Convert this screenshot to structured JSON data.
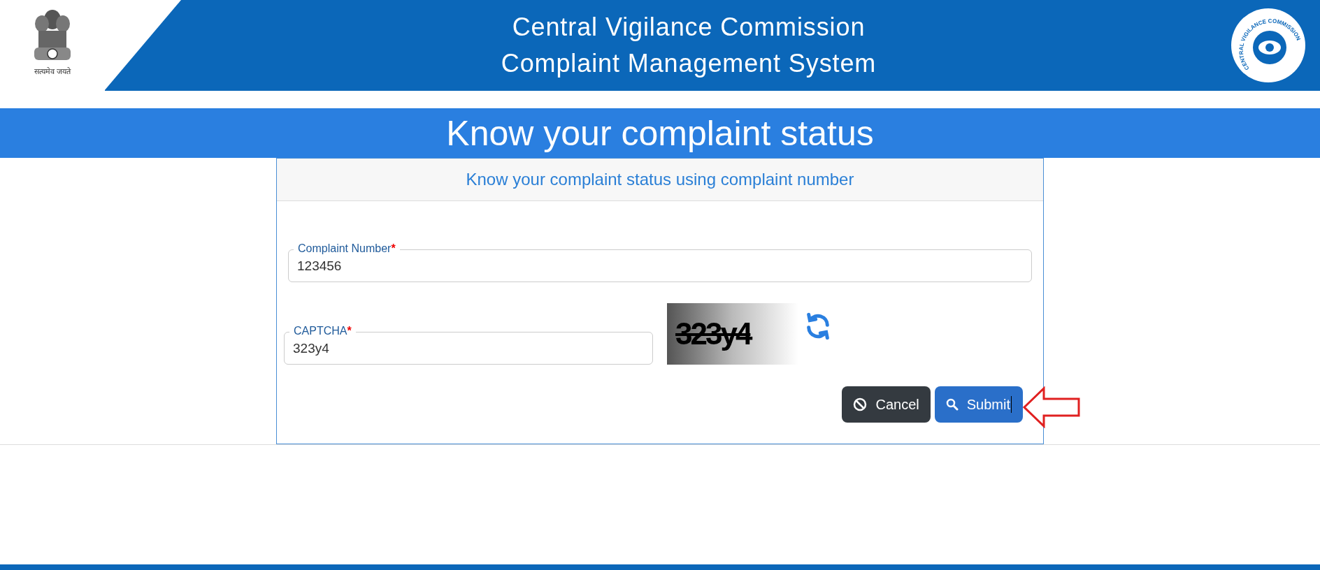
{
  "header": {
    "emblem_motto": "सत्यमेव जयते",
    "title_lines": [
      "Central Vigilance Commission",
      "Complaint Management System"
    ],
    "logo_text": "CENTRAL VIGILANCE COMMISSION"
  },
  "banner": {
    "title": "Know your complaint status"
  },
  "form": {
    "heading": "Know your complaint status using complaint number",
    "fields": [
      {
        "label": "Complaint Number",
        "required": "*",
        "value": "123456"
      }
    ],
    "captcha": {
      "label": "CAPTCHA",
      "required": "*",
      "value": "323y4",
      "image_text": "323y4"
    },
    "buttons": [
      {
        "kind": "cancel",
        "label": "Cancel"
      },
      {
        "kind": "submit",
        "label": "Submit",
        "focused": true
      }
    ]
  }
}
